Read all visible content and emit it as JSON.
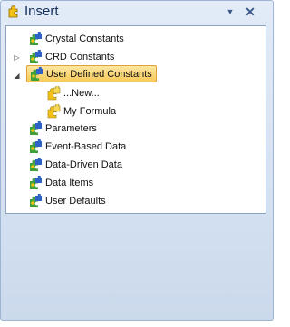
{
  "window": {
    "title": "Insert"
  },
  "titlebar": {
    "pin_icon": "pin-down-icon",
    "close_icon": "close-icon"
  },
  "tree": {
    "items": [
      {
        "label": "Crystal Constants",
        "icon": "puzzle-icon",
        "expander": "none"
      },
      {
        "label": "CRD Constants",
        "icon": "puzzle-icon",
        "expander": "collapsed"
      },
      {
        "label": "User Defined Constants",
        "icon": "puzzle-icon",
        "expander": "expanded",
        "selected": true,
        "children": [
          {
            "label": "...New...",
            "icon": "puzzle-yellow-icon"
          },
          {
            "label": "My Formula",
            "icon": "puzzle-yellow-icon"
          }
        ]
      },
      {
        "label": "Parameters",
        "icon": "puzzle-icon",
        "expander": "none"
      },
      {
        "label": "Event-Based Data",
        "icon": "puzzle-icon",
        "expander": "none"
      },
      {
        "label": "Data-Driven Data",
        "icon": "puzzle-icon",
        "expander": "none"
      },
      {
        "label": "Data Items",
        "icon": "puzzle-icon",
        "expander": "none"
      },
      {
        "label": "User Defaults",
        "icon": "puzzle-icon",
        "expander": "none"
      }
    ]
  },
  "colors": {
    "selection": "#f8c95a",
    "puzzle_green": "#3f9f3a",
    "puzzle_blue": "#2f62c8",
    "puzzle_yellow": "#f2c218"
  }
}
